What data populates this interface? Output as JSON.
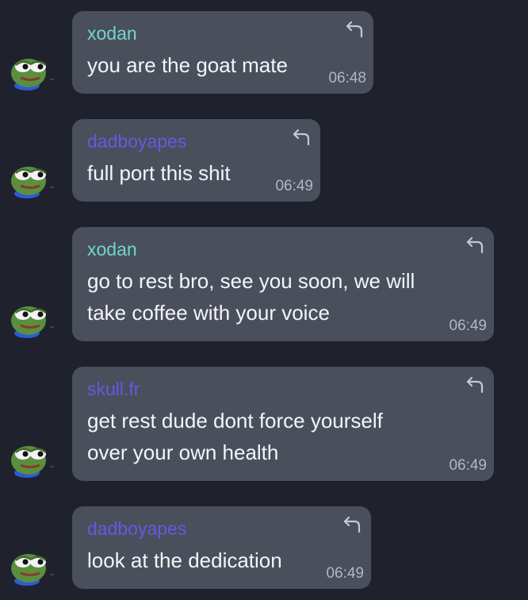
{
  "colors": {
    "background": "#1f222d",
    "bubble": "#4a4f5c",
    "sender_teal": "#6fd6ce",
    "sender_purple": "#6b56e0",
    "text": "#f4f5f7",
    "timestamp": "#b2b6bf"
  },
  "icons": {
    "avatar": "pepe-frog-avatar",
    "reply": "reply-arrow-icon"
  },
  "messages": [
    {
      "sender": "xodan",
      "sender_color": "#6fd6ce",
      "lines": [
        "you are the goat mate"
      ],
      "time": "06:48"
    },
    {
      "sender": "dadboyapes",
      "sender_color": "#6b56e0",
      "lines": [
        "full port this shit"
      ],
      "time": "06:49"
    },
    {
      "sender": "xodan",
      "sender_color": "#6fd6ce",
      "lines": [
        "go to rest bro, see you soon, we will",
        "take coffee with your voice"
      ],
      "time": "06:49"
    },
    {
      "sender": "skull.fr",
      "sender_color": "#6b56e0",
      "lines": [
        "get rest dude dont force yourself",
        "over your own health"
      ],
      "time": "06:49"
    },
    {
      "sender": "dadboyapes",
      "sender_color": "#6b56e0",
      "lines": [
        "look at the dedication"
      ],
      "time": "06:49"
    }
  ]
}
